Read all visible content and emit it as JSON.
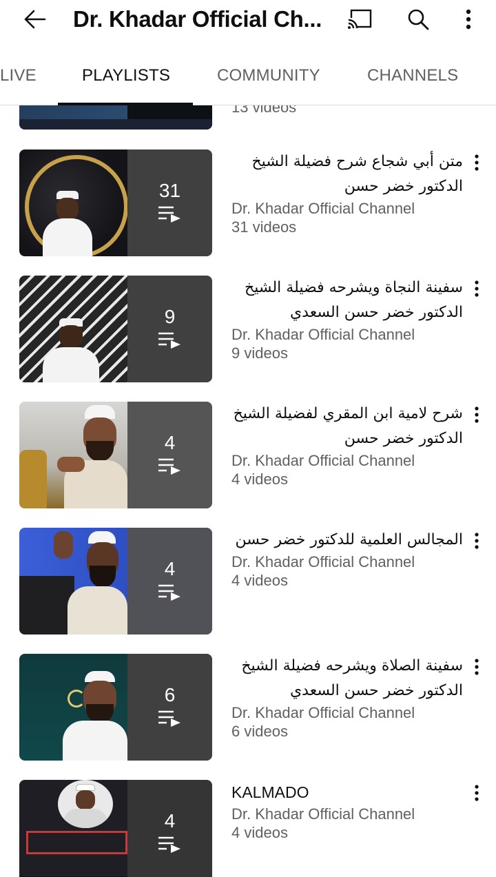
{
  "appbar": {
    "title": "Dr. Khadar Official Ch...",
    "icons": [
      "back-arrow-icon",
      "cast-icon",
      "search-icon",
      "more-vert-icon"
    ]
  },
  "tabs": [
    {
      "label": "LIVE",
      "active": false
    },
    {
      "label": "PLAYLISTS",
      "active": true
    },
    {
      "label": "COMMUNITY",
      "active": false
    },
    {
      "label": "CHANNELS",
      "active": false
    }
  ],
  "partial_item": {
    "video_count": "13 videos"
  },
  "playlists": [
    {
      "title": "متن أبي شجاع  شرح فضيلة الشيخ الدكتور خضر حسن",
      "channel": "Dr. Khadar Official Channel",
      "video_count": "31 videos",
      "count": "31",
      "rtl": true
    },
    {
      "title": "سفينة النجاة ويشرحه فضيلة الشيخ الدكتور خضر حسن السعدي",
      "channel": "Dr. Khadar Official Channel",
      "video_count": "9 videos",
      "count": "9",
      "rtl": true
    },
    {
      "title": "شرح لامية ابن المقري لفضيلة الشيخ الدكتور خضر حسن",
      "channel": "Dr. Khadar Official Channel",
      "video_count": "4 videos",
      "count": "4",
      "rtl": true
    },
    {
      "title": "المجالس العلمية للدكتور خضر حسن",
      "channel": "Dr. Khadar Official Channel",
      "video_count": "4 videos",
      "count": "4",
      "rtl": true
    },
    {
      "title": "سفينة الصلاة ويشرحه فضيلة الشيخ الدكتور خضر حسن السعدي",
      "channel": "Dr. Khadar Official Channel",
      "video_count": "6 videos",
      "count": "6",
      "rtl": true
    },
    {
      "title": "KALMADO",
      "channel": "Dr. Khadar Official Channel",
      "video_count": "4 videos",
      "count": "4",
      "rtl": false
    }
  ]
}
